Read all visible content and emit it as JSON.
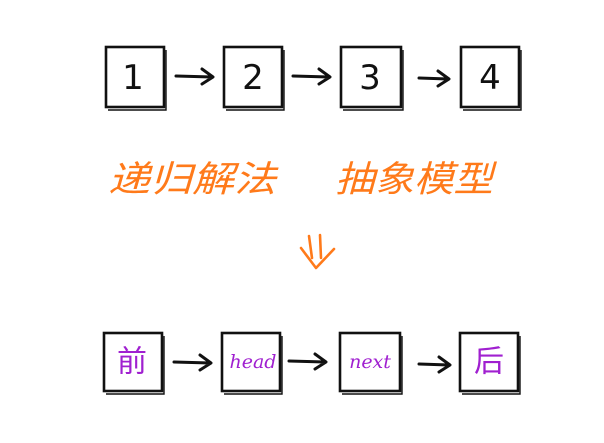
{
  "top_row": {
    "nodes": [
      "1",
      "2",
      "3",
      "4"
    ]
  },
  "captions": {
    "left": "递归解法",
    "right": "抽象模型"
  },
  "bottom_row": {
    "nodes": [
      "前",
      "head",
      "next",
      "后"
    ]
  },
  "colors": {
    "stroke": "#111111",
    "caption": "#ff7a1a",
    "model_text": "#a020d0"
  }
}
